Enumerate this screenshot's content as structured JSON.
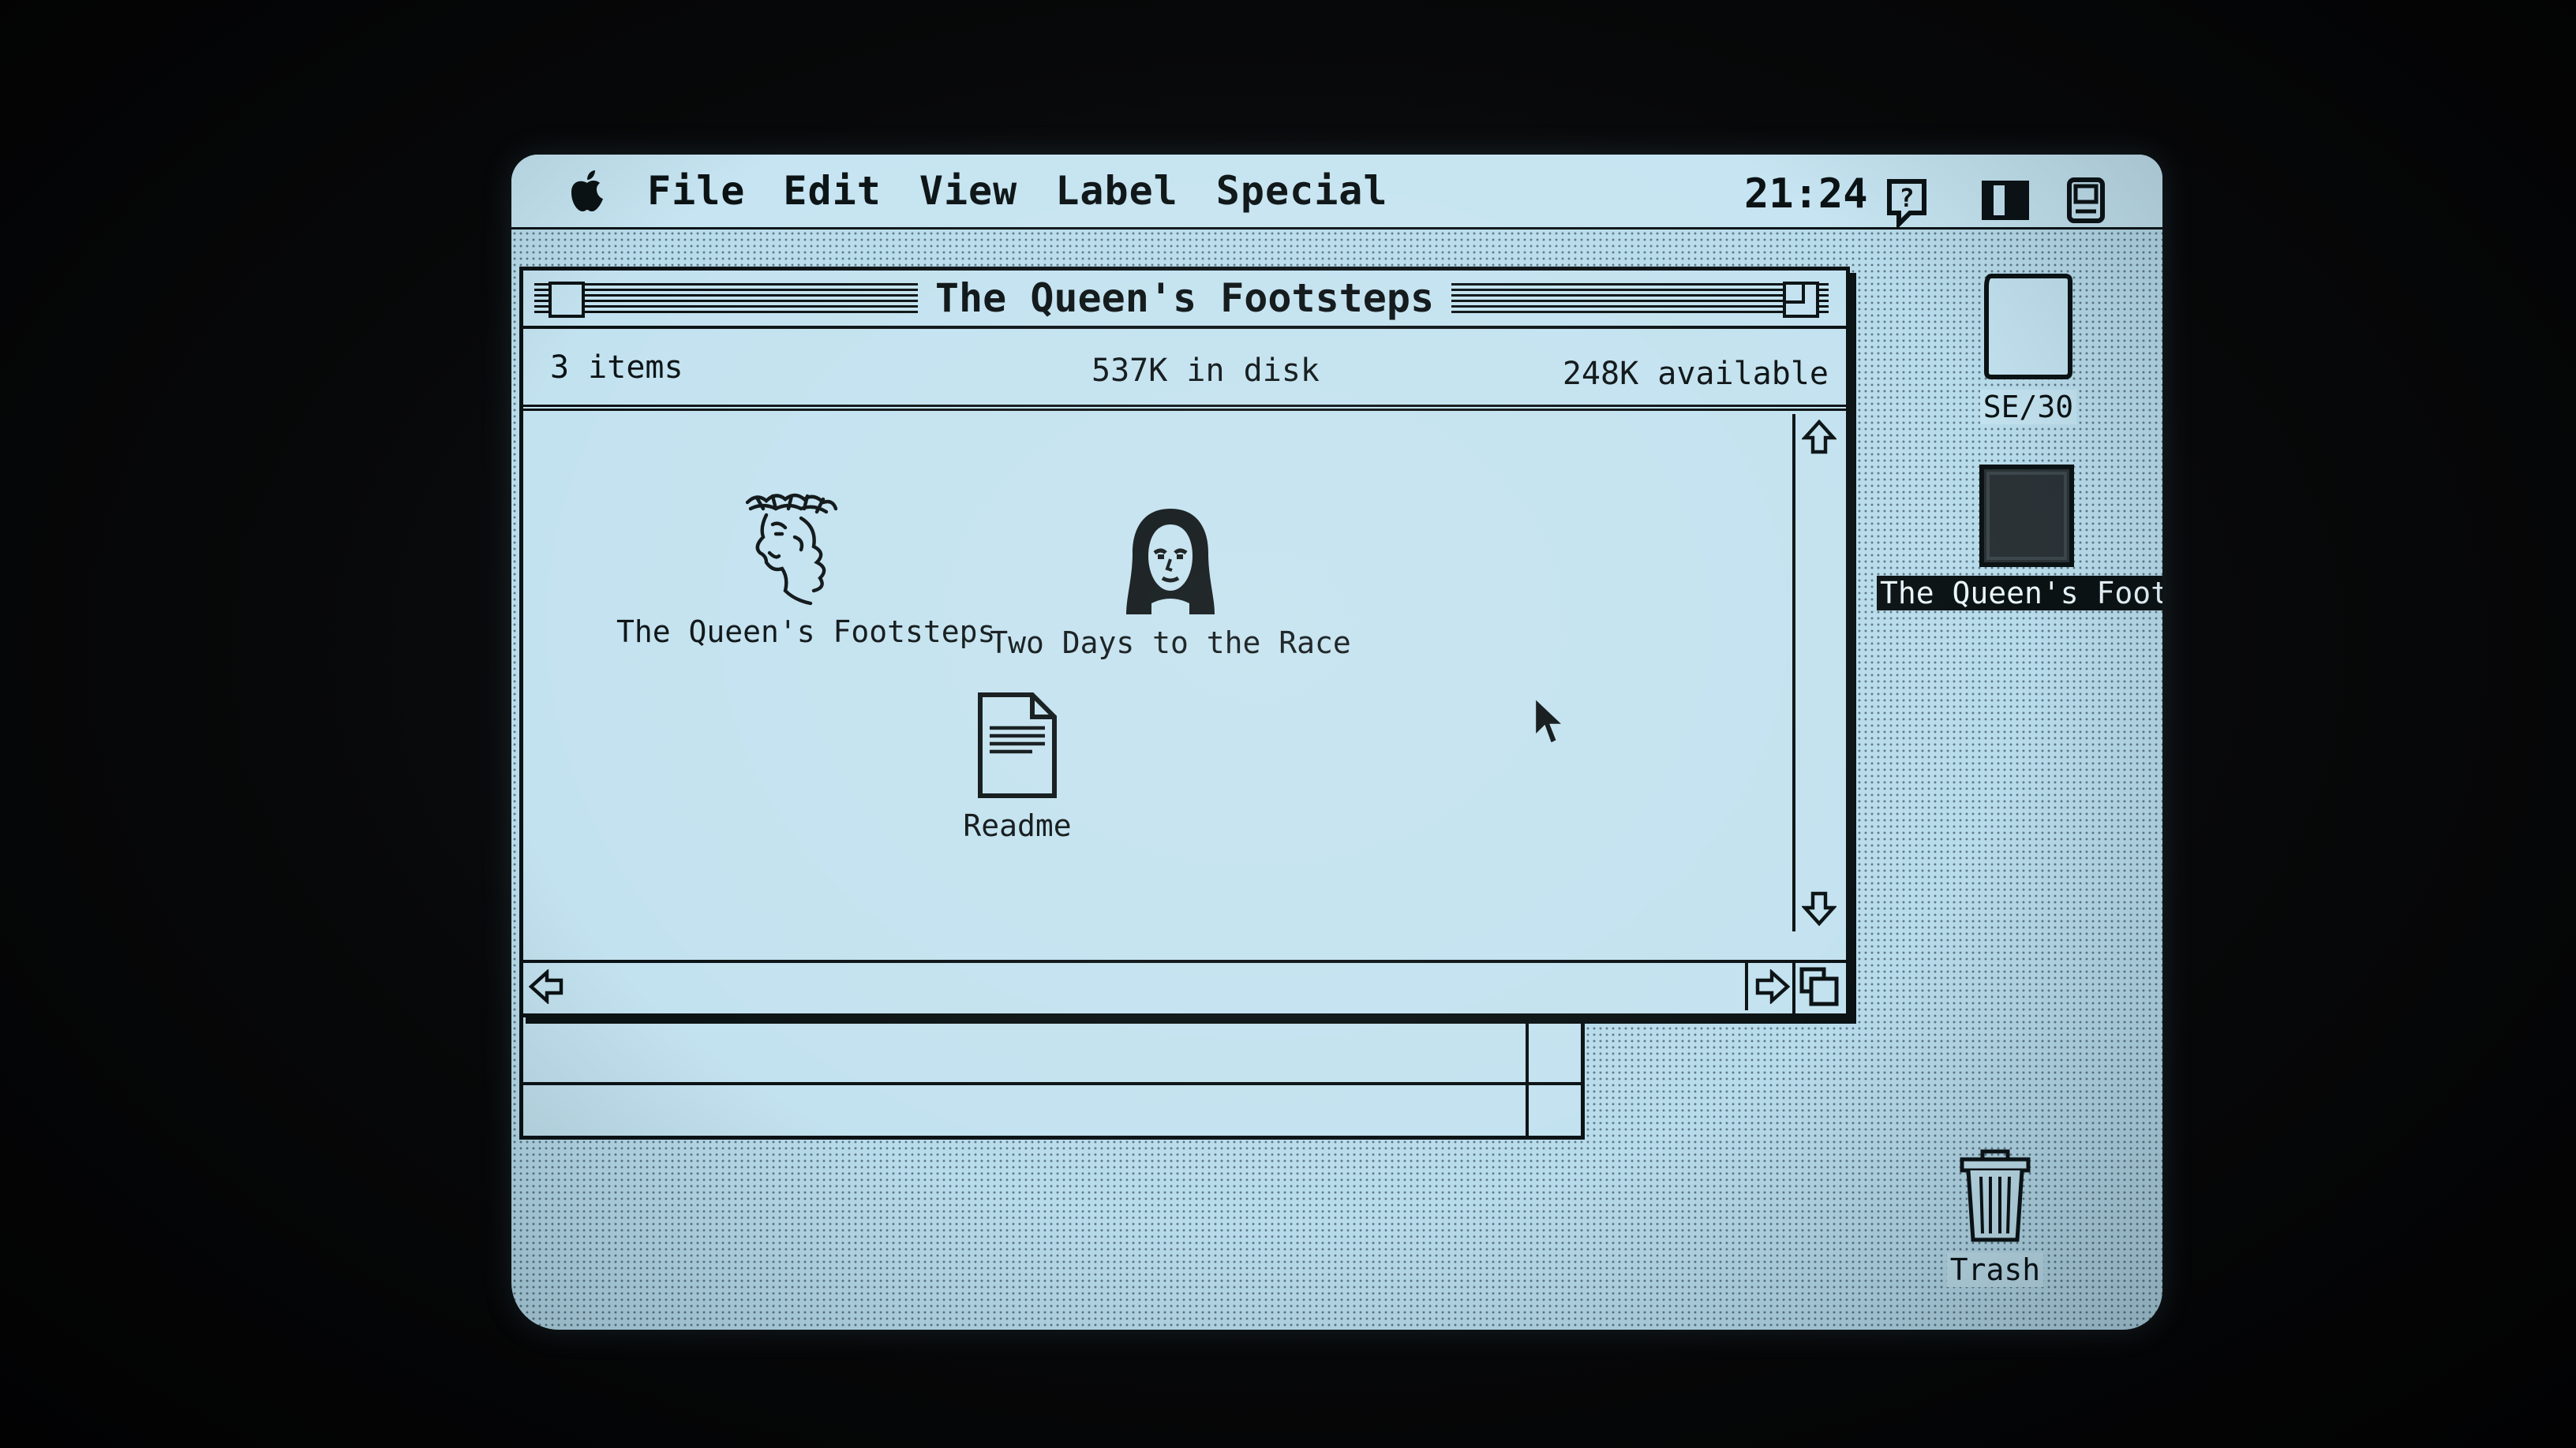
{
  "menubar": {
    "apple_icon": "apple-icon",
    "items": [
      "File",
      "Edit",
      "View",
      "Label",
      "Special"
    ],
    "clock": "21:24",
    "icons": [
      "help-balloon-icon",
      "application-menu-icon",
      "finder-icon"
    ]
  },
  "window": {
    "title": "The Queen's Footsteps",
    "item_count": "3 items",
    "disk_usage": "537K in disk",
    "available": "248K available",
    "items": [
      {
        "label": "The Queen's Footsteps",
        "icon": "queen-head-icon"
      },
      {
        "label": "Two Days to the Race",
        "icon": "woman-portrait-icon"
      },
      {
        "label": "Readme",
        "icon": "document-icon"
      }
    ]
  },
  "desktop": {
    "disk_label": "SE/30",
    "volume_label": "The Queen's Footste",
    "trash_label": "Trash"
  },
  "colors": {
    "screen": "#c3e2ef",
    "ink": "#0b1214"
  }
}
